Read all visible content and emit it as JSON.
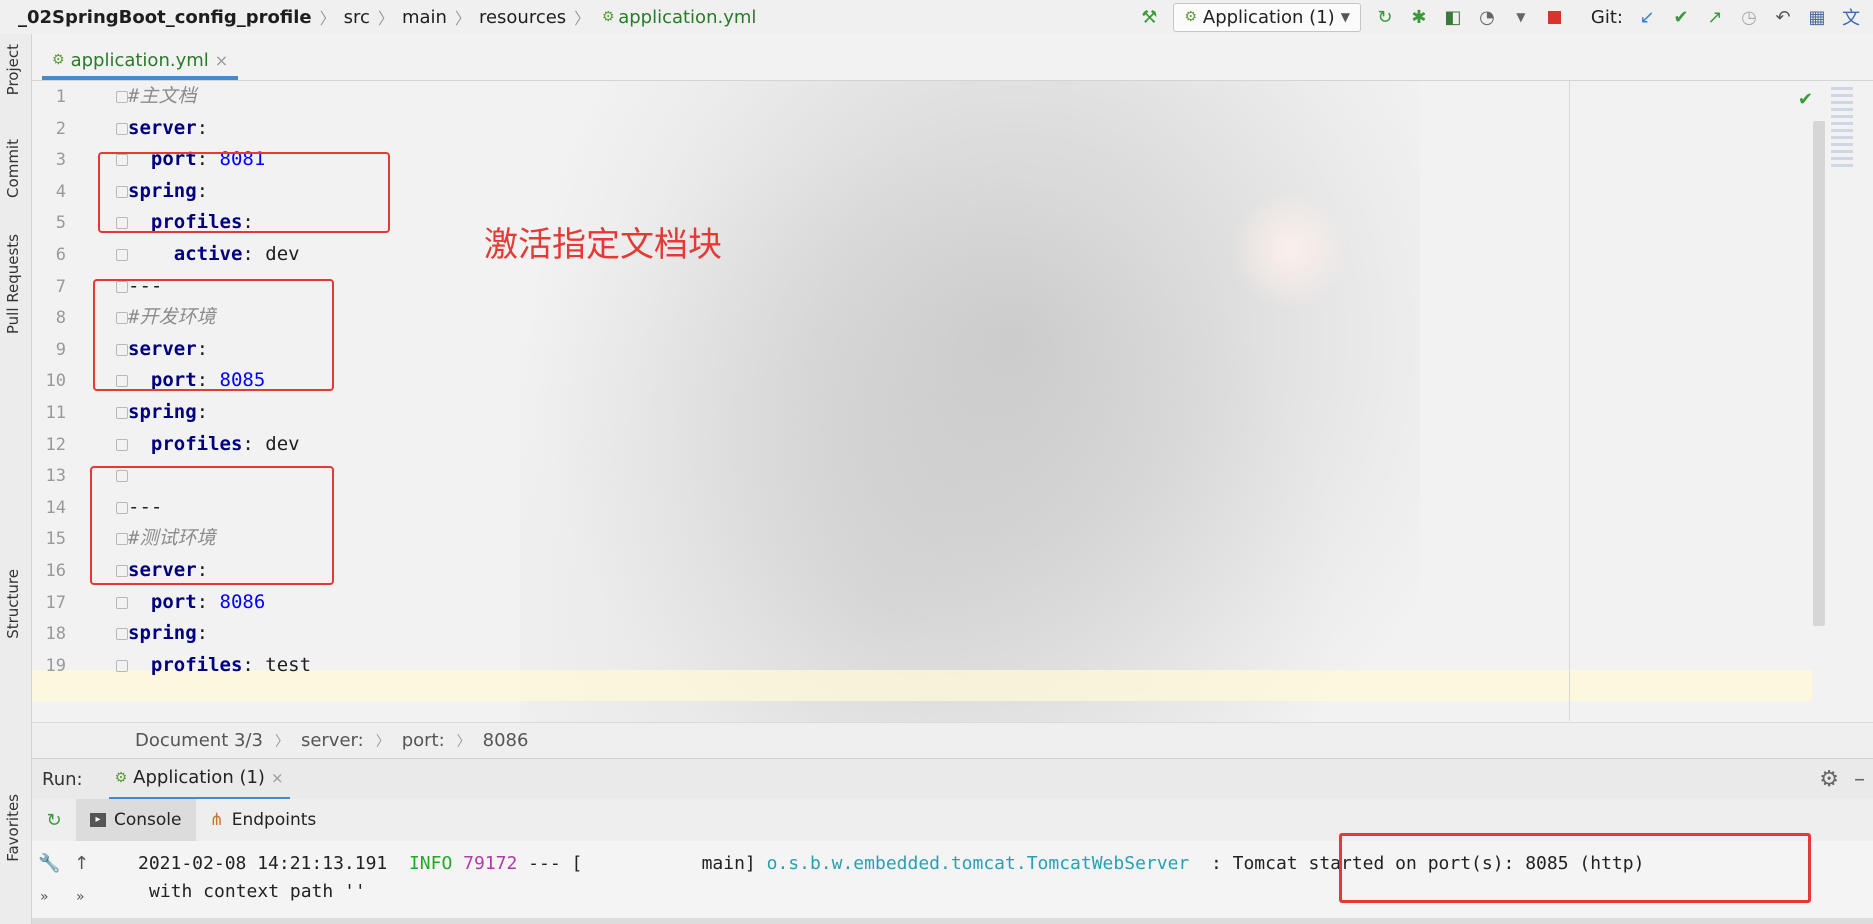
{
  "breadcrumb": {
    "segments": [
      "_02SpringBoot_config_profile",
      "src",
      "main",
      "resources"
    ],
    "file": "application.yml"
  },
  "toolbar": {
    "run_config": "Application (1)",
    "git_label": "Git:"
  },
  "left_stripe": {
    "project": "Project",
    "commit": "Commit",
    "pull_requests": "Pull Requests",
    "structure": "Structure",
    "favorites": "Favorites"
  },
  "editor_tab": {
    "label": "application.yml",
    "close": "×"
  },
  "code_lines": [
    {
      "no": "1",
      "parts": [
        [
          "c",
          "#主文档"
        ]
      ]
    },
    {
      "no": "2",
      "parts": [
        [
          "k",
          "server"
        ],
        [
          "v",
          ":"
        ]
      ]
    },
    {
      "no": "3",
      "parts": [
        [
          "v",
          "  "
        ],
        [
          "k",
          "port"
        ],
        [
          "v",
          ": "
        ],
        [
          "n",
          "8081"
        ]
      ]
    },
    {
      "no": "4",
      "parts": [
        [
          "k",
          "spring"
        ],
        [
          "v",
          ":"
        ]
      ]
    },
    {
      "no": "5",
      "parts": [
        [
          "v",
          "  "
        ],
        [
          "k",
          "profiles"
        ],
        [
          "v",
          ":"
        ]
      ]
    },
    {
      "no": "6",
      "parts": [
        [
          "v",
          "    "
        ],
        [
          "k",
          "active"
        ],
        [
          "v",
          ": dev"
        ]
      ]
    },
    {
      "no": "7",
      "parts": [
        [
          "v",
          "---"
        ]
      ]
    },
    {
      "no": "8",
      "parts": [
        [
          "c",
          "#开发环境"
        ]
      ]
    },
    {
      "no": "9",
      "parts": [
        [
          "k",
          "server"
        ],
        [
          "v",
          ":"
        ]
      ]
    },
    {
      "no": "10",
      "parts": [
        [
          "v",
          "  "
        ],
        [
          "k",
          "port"
        ],
        [
          "v",
          ": "
        ],
        [
          "n",
          "8085"
        ]
      ]
    },
    {
      "no": "11",
      "parts": [
        [
          "k",
          "spring"
        ],
        [
          "v",
          ":"
        ]
      ]
    },
    {
      "no": "12",
      "parts": [
        [
          "v",
          "  "
        ],
        [
          "k",
          "profiles"
        ],
        [
          "v",
          ": dev"
        ]
      ]
    },
    {
      "no": "13",
      "parts": []
    },
    {
      "no": "14",
      "parts": [
        [
          "v",
          "---"
        ]
      ]
    },
    {
      "no": "15",
      "parts": [
        [
          "c",
          "#测试环境"
        ]
      ]
    },
    {
      "no": "16",
      "parts": [
        [
          "k",
          "server"
        ],
        [
          "v",
          ":"
        ]
      ]
    },
    {
      "no": "17",
      "parts": [
        [
          "v",
          "  "
        ],
        [
          "k",
          "port"
        ],
        [
          "v",
          ": "
        ],
        [
          "n",
          "8086"
        ]
      ]
    },
    {
      "no": "18",
      "parts": [
        [
          "k",
          "spring"
        ],
        [
          "v",
          ":"
        ]
      ]
    },
    {
      "no": "19",
      "parts": [
        [
          "v",
          "  "
        ],
        [
          "k",
          "profiles"
        ],
        [
          "v",
          ": test"
        ]
      ]
    }
  ],
  "annotation": "激活指定文档块",
  "editor_breadcrumb": [
    "Document 3/3",
    "server:",
    "port:",
    "8086"
  ],
  "run_window": {
    "label": "Run:",
    "tab": "Application (1)",
    "subtabs": [
      "Console",
      "Endpoints"
    ]
  },
  "console": {
    "timestamp": "2021-02-08 14:21:13.191",
    "level": "INFO",
    "pid": "79172",
    "sep": "--- [",
    "thread": "main]",
    "logger": "o.s.b.w.embedded.tomcat.TomcatWebServer",
    "colon": ":",
    "message": "Tomcat started on port(s): 8085 (http)",
    "line2": "with context path ''"
  }
}
